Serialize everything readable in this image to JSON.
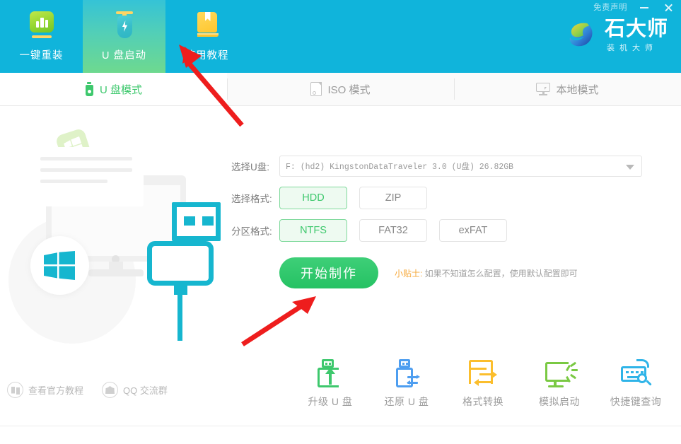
{
  "window": {
    "disclaimer": "免责声明",
    "minimize_icon": "minimize-icon",
    "close_icon": "close-icon"
  },
  "brand": {
    "name": "石大师",
    "subtitle": "装机大师",
    "logo_icon": "shidashi-logo-icon"
  },
  "main_tabs": [
    {
      "label": "一键重装",
      "icon": "chart-monitor-icon",
      "active": false
    },
    {
      "label": "U 盘启动",
      "icon": "battery-flash-icon",
      "active": true
    },
    {
      "label": "使用教程",
      "icon": "book-icon",
      "active": false
    }
  ],
  "sub_tabs": [
    {
      "label": "U 盘模式",
      "icon": "usb-drive-icon",
      "active": true
    },
    {
      "label": "ISO 模式",
      "icon": "iso-file-icon",
      "active": false
    },
    {
      "label": "本地模式",
      "icon": "local-monitor-icon",
      "active": false
    }
  ],
  "form": {
    "usb_label": "选择U盘:",
    "usb_value": "F: (hd2) KingstonDataTraveler 3.0 (U盘) 26.82GB",
    "usb_caret_icon": "chevron-down-icon",
    "format_label": "选择格式:",
    "format_options": [
      {
        "label": "HDD",
        "selected": true
      },
      {
        "label": "ZIP",
        "selected": false
      }
    ],
    "partition_label": "分区格式:",
    "partition_options": [
      {
        "label": "NTFS",
        "selected": true
      },
      {
        "label": "FAT32",
        "selected": false
      },
      {
        "label": "exFAT",
        "selected": false
      }
    ],
    "start_button": "开始制作",
    "tip_key": "小贴士:",
    "tip_text": " 如果不知道怎么配置，使用默认配置即可"
  },
  "illustration": {
    "name": "usb-boot-illustration",
    "usb_icon": "usb-plug-icon",
    "monitor_icon": "desktop-monitor-icon",
    "windows_icon": "windows-logo-icon",
    "windows_badge_icon": "windows-badge-icon"
  },
  "footer_links": [
    {
      "label": "查看官方教程",
      "icon": "book-circle-icon"
    },
    {
      "label": "QQ 交流群",
      "icon": "people-circle-icon"
    }
  ],
  "tools": [
    {
      "label": "升级 U 盘",
      "icon": "usb-upgrade-icon"
    },
    {
      "label": "还原 U 盘",
      "icon": "usb-restore-icon"
    },
    {
      "label": "格式转换",
      "icon": "format-convert-icon"
    },
    {
      "label": "模拟启动",
      "icon": "simulate-boot-icon"
    },
    {
      "label": "快捷键查询",
      "icon": "shortcut-search-icon"
    }
  ],
  "annotations": [
    {
      "name": "arrow-to-usb-boot-tab",
      "color": "#ee1d1d"
    },
    {
      "name": "arrow-to-start-button",
      "color": "#ee1d1d"
    }
  ],
  "colors": {
    "header_blue": "#10b4db",
    "accent_green": "#3ec86d",
    "usb_cyan": "#16b6cf",
    "tip_orange": "#f6a93b",
    "arrow_red": "#ee1d1d"
  }
}
